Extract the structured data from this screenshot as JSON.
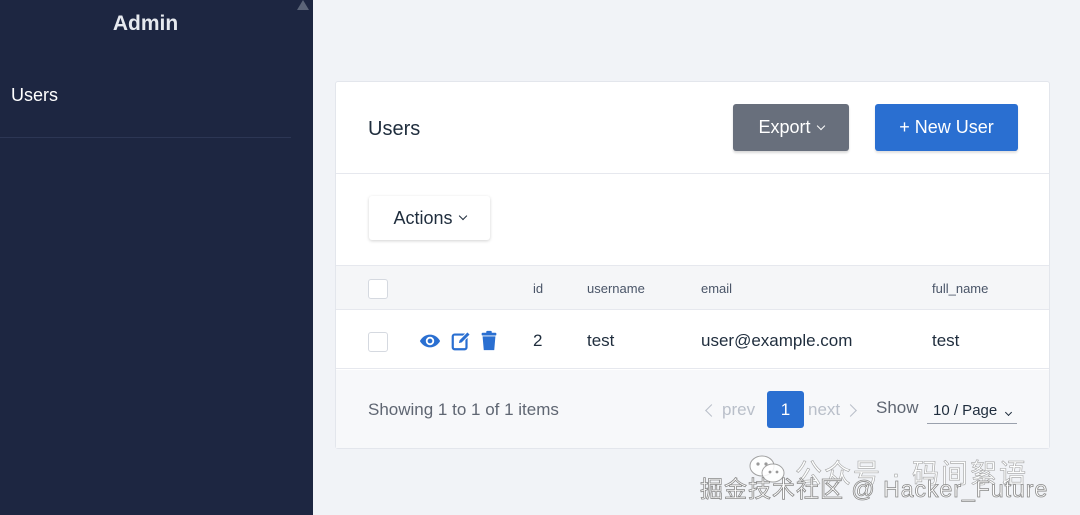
{
  "sidebar": {
    "title": "Admin",
    "items": [
      {
        "label": "Users"
      }
    ]
  },
  "card": {
    "title": "Users",
    "export_label": "Export",
    "new_user_label": "+ New User",
    "actions_label": "Actions"
  },
  "table": {
    "columns": [
      "id",
      "username",
      "email",
      "full_name"
    ],
    "rows": [
      {
        "id": "2",
        "username": "test",
        "email": "user@example.com",
        "full_name": "test"
      }
    ],
    "row_icons": [
      "eye-icon",
      "edit-icon",
      "trash-icon"
    ]
  },
  "footer": {
    "showing": "Showing 1 to 1 of 1 items",
    "prev": "prev",
    "next": "next",
    "current_page": "1",
    "show_label": "Show",
    "page_size": "10 / Page"
  },
  "watermark": {
    "line1": "公众号 · 码间絮语",
    "line2": "掘金技术社区 @ Hacker_Future"
  },
  "colors": {
    "sidebar_bg": "#1d2641",
    "primary": "#2a6fd1",
    "export_bg": "#686f7c",
    "page_bg": "#f1f3f7"
  }
}
